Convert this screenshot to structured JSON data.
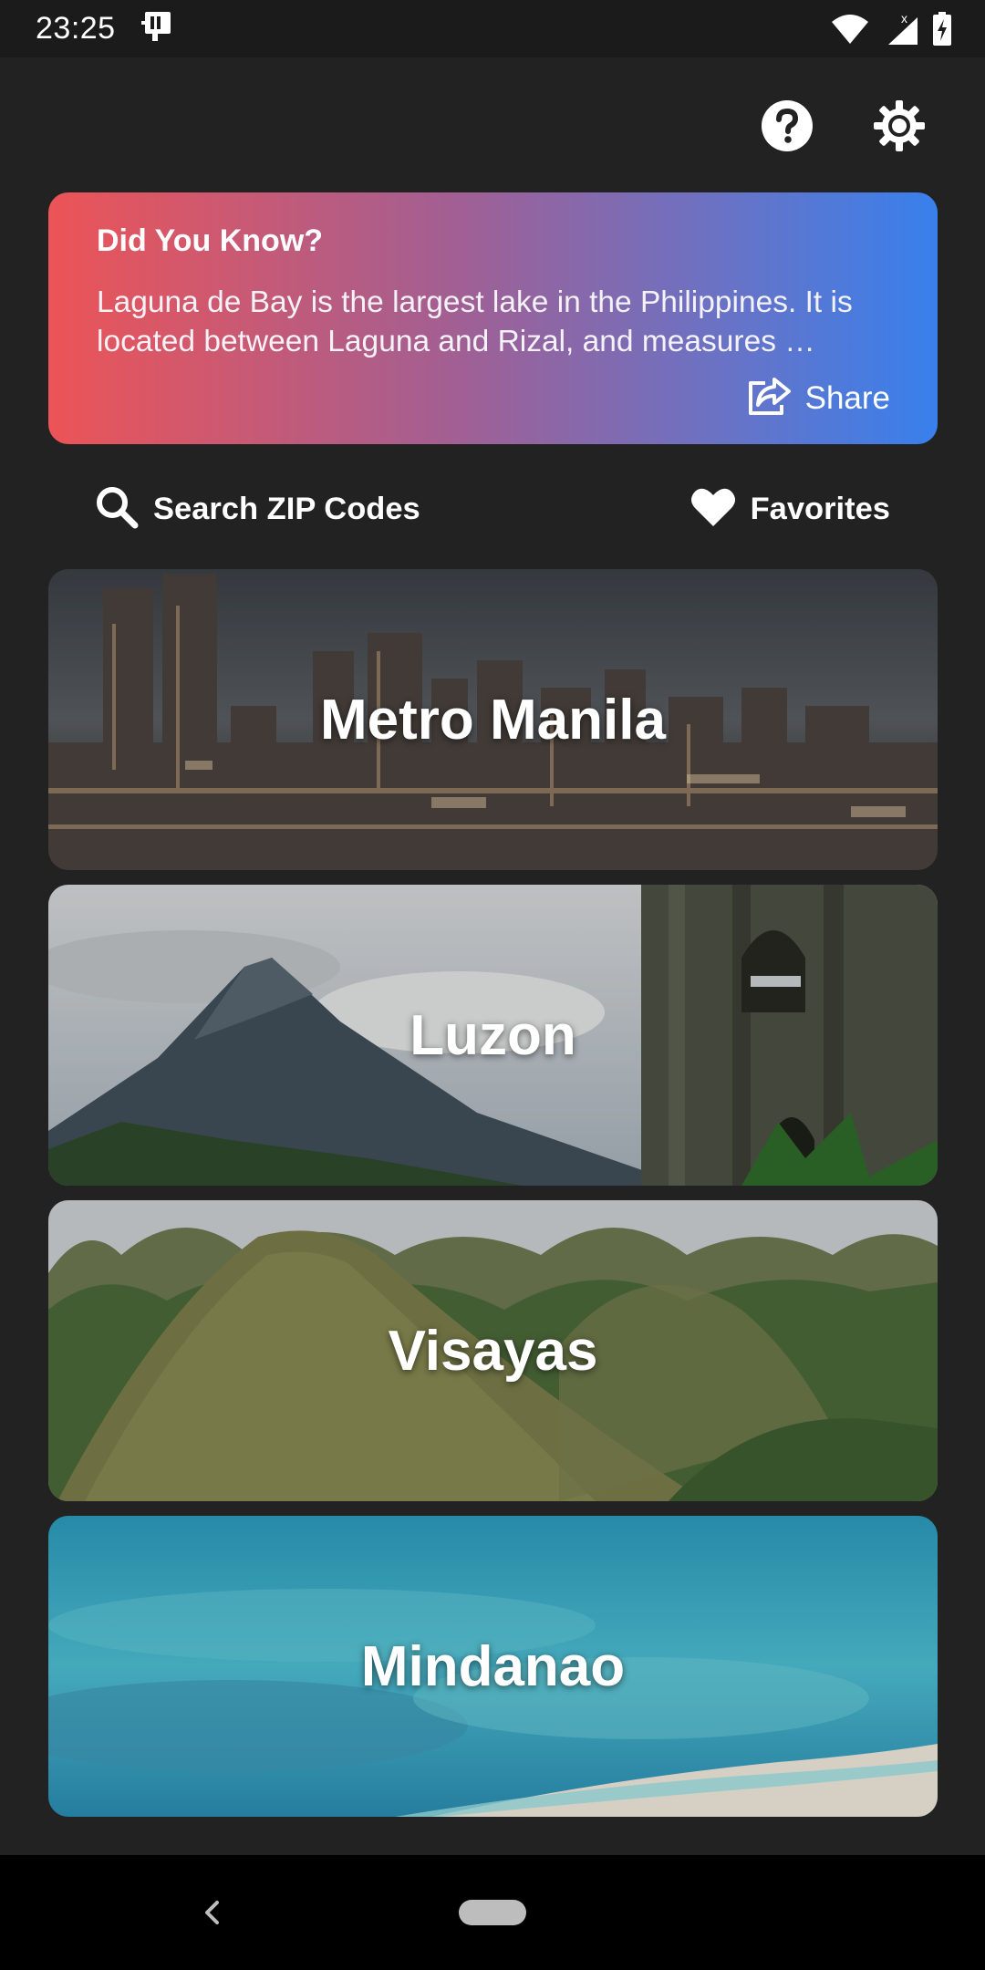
{
  "status_bar": {
    "time": "23:25",
    "icons": [
      "sim-card-icon",
      "wifi-icon",
      "cell-signal-icon",
      "battery-charging-icon"
    ]
  },
  "top_actions": {
    "help_icon": "help-circle-icon",
    "settings_icon": "gear-icon"
  },
  "fact_card": {
    "title": "Did You Know?",
    "text": "Laguna de Bay is the largest lake in the Philippines. It is located between Laguna and Rizal, and measures …",
    "share_label": "Share",
    "gradient": [
      "#ec5457",
      "#a35f92",
      "#3880ec"
    ]
  },
  "quick_links": {
    "search_label": "Search ZIP Codes",
    "favorites_label": "Favorites"
  },
  "regions": [
    {
      "name": "Metro Manila"
    },
    {
      "name": "Luzon"
    },
    {
      "name": "Visayas"
    },
    {
      "name": "Mindanao"
    }
  ],
  "colors": {
    "background": "#222222",
    "status_bar": "#1b1b1b",
    "nav_bar": "#000000"
  }
}
